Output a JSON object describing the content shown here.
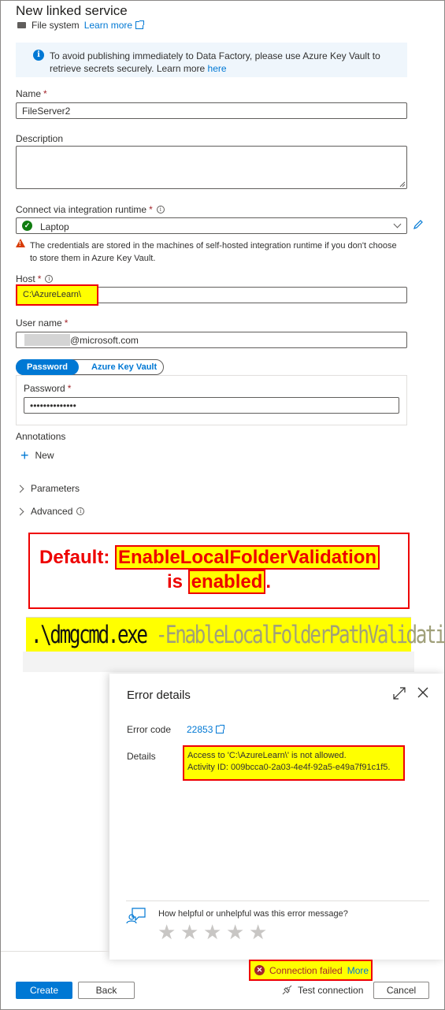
{
  "header": {
    "title": "New linked service",
    "connector": "File system",
    "learn_more": "Learn more"
  },
  "info": {
    "text": "To avoid publishing immediately to Data Factory, please use Azure Key Vault to retrieve secrets securely. Learn more",
    "link": "here"
  },
  "form": {
    "name_label": "Name",
    "name_value": "FileServer2",
    "description_label": "Description",
    "description_value": "",
    "runtime_label": "Connect via integration runtime",
    "runtime_value": "Laptop",
    "runtime_warning": "The credentials are stored in the machines of self-hosted integration runtime if you don't choose to store them in Azure Key Vault.",
    "host_label": "Host",
    "host_value": "C:\\AzureLearn\\",
    "username_label": "User name",
    "username_value": "@microsoft.com",
    "toggle_password": "Password",
    "toggle_keyvault": "Azure Key Vault",
    "password_label": "Password",
    "password_value": "••••••••••••••",
    "annotations_label": "Annotations",
    "new_label": "New",
    "parameters_label": "Parameters",
    "advanced_label": "Advanced",
    "required_mark": "*"
  },
  "callout": {
    "prefix": "Default:",
    "setting": "EnableLocalFolderValidation",
    "is": "is",
    "state": "enabled",
    "period": "."
  },
  "command": {
    "exe": ".\\dmgcmd.exe",
    "param": "-EnableLocalFolderPathValidation"
  },
  "error_panel": {
    "title": "Error details",
    "code_label": "Error code",
    "code_value": "22853",
    "details_label": "Details",
    "details_line1": "Access to 'C:\\AzureLearn\\' is not allowed.",
    "details_line2": "Activity ID: 009bcca0-2a03-4e4f-92a5-e49a7f91c1f5.",
    "feedback_question": "How helpful or unhelpful was this error message?",
    "rating": 0
  },
  "footer": {
    "create": "Create",
    "back": "Back",
    "connection_status": "Connection failed",
    "more": "More",
    "test_connection": "Test connection",
    "cancel": "Cancel"
  },
  "colors": {
    "accent": "#0078d4",
    "highlight": "#ffff00",
    "annotation_red": "#e00000",
    "error": "#a4262c",
    "success": "#107c10"
  }
}
